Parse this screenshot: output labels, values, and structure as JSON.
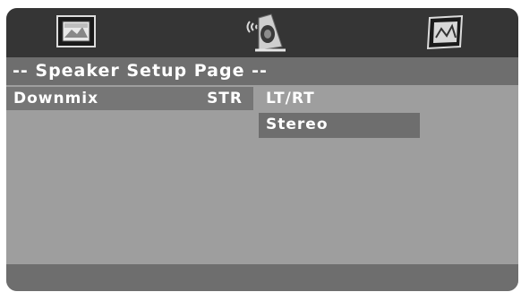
{
  "tabs": [
    {
      "icon": "general-setup-icon"
    },
    {
      "icon": "speaker-setup-icon"
    },
    {
      "icon": "preferences-icon"
    }
  ],
  "page_title": "-- Speaker Setup Page --",
  "settings": [
    {
      "label": "Downmix",
      "value": "STR"
    }
  ],
  "options": [
    {
      "label": "LT/RT",
      "selected": false
    },
    {
      "label": "Stereo",
      "selected": true
    }
  ],
  "colors": {
    "background": "#9e9e9e",
    "icon_bar": "#353535",
    "highlight": "#6e6e6e",
    "row_highlight": "#767676",
    "text": "#ffffff"
  }
}
